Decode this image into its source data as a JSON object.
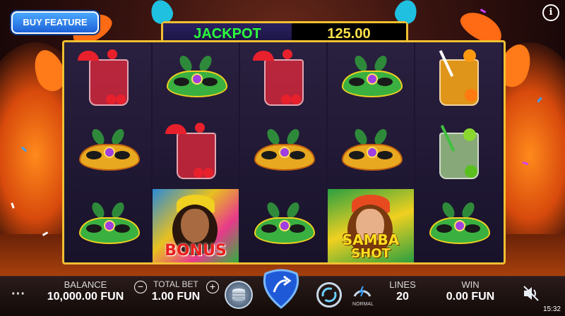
{
  "buy_feature": {
    "label": "BUY FEATURE"
  },
  "info": {
    "icon": "info-icon",
    "glyph": "i"
  },
  "jackpot": {
    "label": "JACKPOT",
    "value": "125.00"
  },
  "reels": [
    [
      "cocktail-red",
      "mask-gold",
      "mask-green"
    ],
    [
      "mask-green",
      "cocktail-red",
      "bonus"
    ],
    [
      "cocktail-red",
      "mask-gold",
      "mask-green"
    ],
    [
      "mask-green",
      "mask-gold",
      "samba-shot"
    ],
    [
      "cocktail-orange",
      "cocktail-lime",
      "mask-green"
    ]
  ],
  "symbols": {
    "bonus_text": "BONUS",
    "samba_text_1": "SAMBA",
    "samba_text_2": "SHOT"
  },
  "bottom": {
    "menu_glyph": "···",
    "balance_label": "BALANCE",
    "balance_value": "10,000.00 FUN",
    "minus_glyph": "−",
    "total_bet_label": "TOTAL BET",
    "total_bet_value": "1.00 FUN",
    "plus_glyph": "+",
    "speed_label": "NORMAL",
    "lines_label": "LINES",
    "lines_value": "20",
    "win_label": "WIN",
    "win_value": "0.00 FUN",
    "clock": "15:32"
  },
  "colors": {
    "frame_gold": "#f0c030",
    "jackpot_green": "#2dff3c",
    "jackpot_yellow": "#ffe14a",
    "buy_blue": "#1d62d8",
    "spin_blue": "#1e5ad8"
  }
}
